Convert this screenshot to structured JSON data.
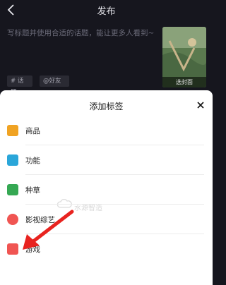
{
  "header": {
    "title": "发布"
  },
  "post": {
    "caption_placeholder": "写标题并使用合适的话题，能让更多人看到~",
    "cover_label": "选封面",
    "topic_chip": "# 话题",
    "friend_chip": "@好友"
  },
  "sheet": {
    "title": "添加标签",
    "watermark": "水源智造",
    "items": [
      {
        "label": "商品",
        "icon": "shopping-bag-icon",
        "color": "#f0a323"
      },
      {
        "label": "功能",
        "icon": "link-icon",
        "color": "#2aa6d9"
      },
      {
        "label": "种草",
        "icon": "sprout-icon",
        "color": "#35a853"
      },
      {
        "label": "影视综艺",
        "icon": "film-reel-icon",
        "color": "#f05552"
      },
      {
        "label": "游戏",
        "icon": "gamepad-icon",
        "color": "#f05552"
      }
    ]
  },
  "annotation": {
    "arrow_color": "#e8231f"
  }
}
